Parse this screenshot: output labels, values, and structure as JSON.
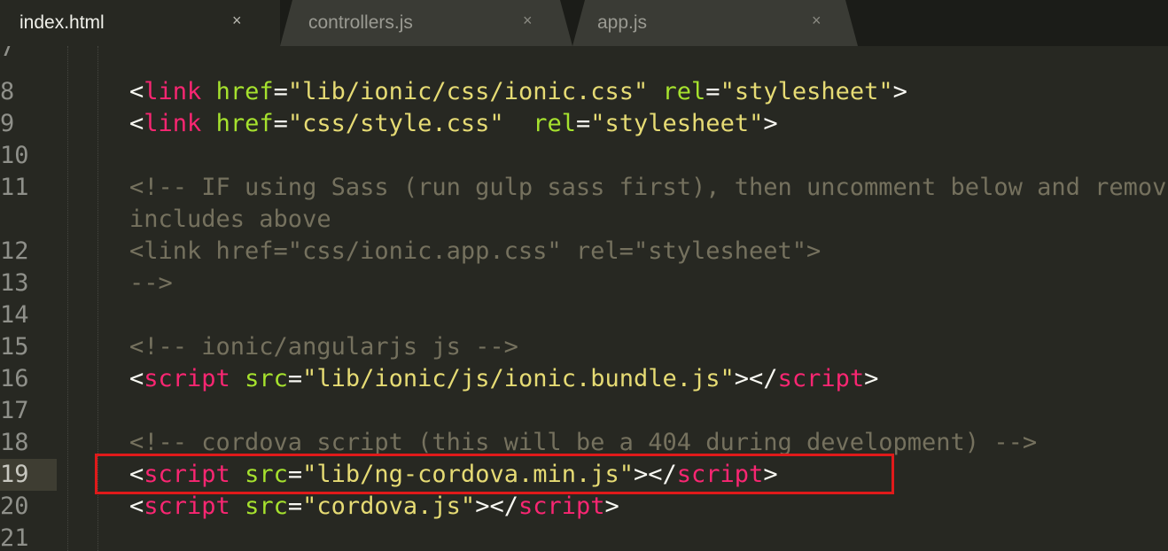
{
  "tabs": [
    {
      "label": "index.html",
      "close": "×",
      "active": true
    },
    {
      "label": "controllers.js",
      "close": "×",
      "active": false
    },
    {
      "label": "app.js",
      "close": "×",
      "active": false
    }
  ],
  "line_numbers": [
    "7",
    "8",
    "9",
    "10",
    "11",
    "",
    "12",
    "13",
    "14",
    "15",
    "16",
    "17",
    "18",
    "19",
    "20",
    "21"
  ],
  "current_line": "19",
  "code": {
    "l8": {
      "lt": "<",
      "tag": "link",
      "a1": "href",
      "eq1": "=",
      "v1": "\"lib/ionic/css/ionic.css\"",
      "a2": "rel",
      "eq2": "=",
      "v2": "\"stylesheet\"",
      "gt": ">"
    },
    "l9": {
      "lt": "<",
      "tag": "link",
      "a1": "href",
      "eq1": "=",
      "v1": "\"css/style.css\"",
      "a2": "rel",
      "eq2": "=",
      "v2": "\"stylesheet\"",
      "gt": ">"
    },
    "l11": "<!-- IF using Sass (run gulp sass first), then uncomment below and remove the CSS",
    "l11b": "includes above",
    "l12": "<link href=\"css/ionic.app.css\" rel=\"stylesheet\">",
    "l13": "-->",
    "l15": "<!-- ionic/angularjs js -->",
    "l16": {
      "lt": "<",
      "tag": "script",
      "a1": "src",
      "eq1": "=",
      "v1": "\"lib/ionic/js/ionic.bundle.js\"",
      "mid": "></",
      "ctag": "script",
      "gt": ">"
    },
    "l18": "<!-- cordova script (this will be a 404 during development) -->",
    "l19": {
      "lt": "<",
      "tag": "script",
      "a1": "src",
      "eq1": "=",
      "v1": "\"lib/ng-cordova.min.js\"",
      "mid": "></",
      "ctag": "script",
      "gt": ">"
    },
    "l20": {
      "lt": "<",
      "tag": "script",
      "a1": "src",
      "eq1": "=",
      "v1": "\"cordova.js\"",
      "mid": "></",
      "ctag": "script",
      "gt": ">"
    }
  },
  "colors": {
    "background": "#272822",
    "tag": "#f92672",
    "attribute": "#a6e22e",
    "string": "#e6db74",
    "comment": "#75715e",
    "highlight_box": "#e01a1a"
  }
}
